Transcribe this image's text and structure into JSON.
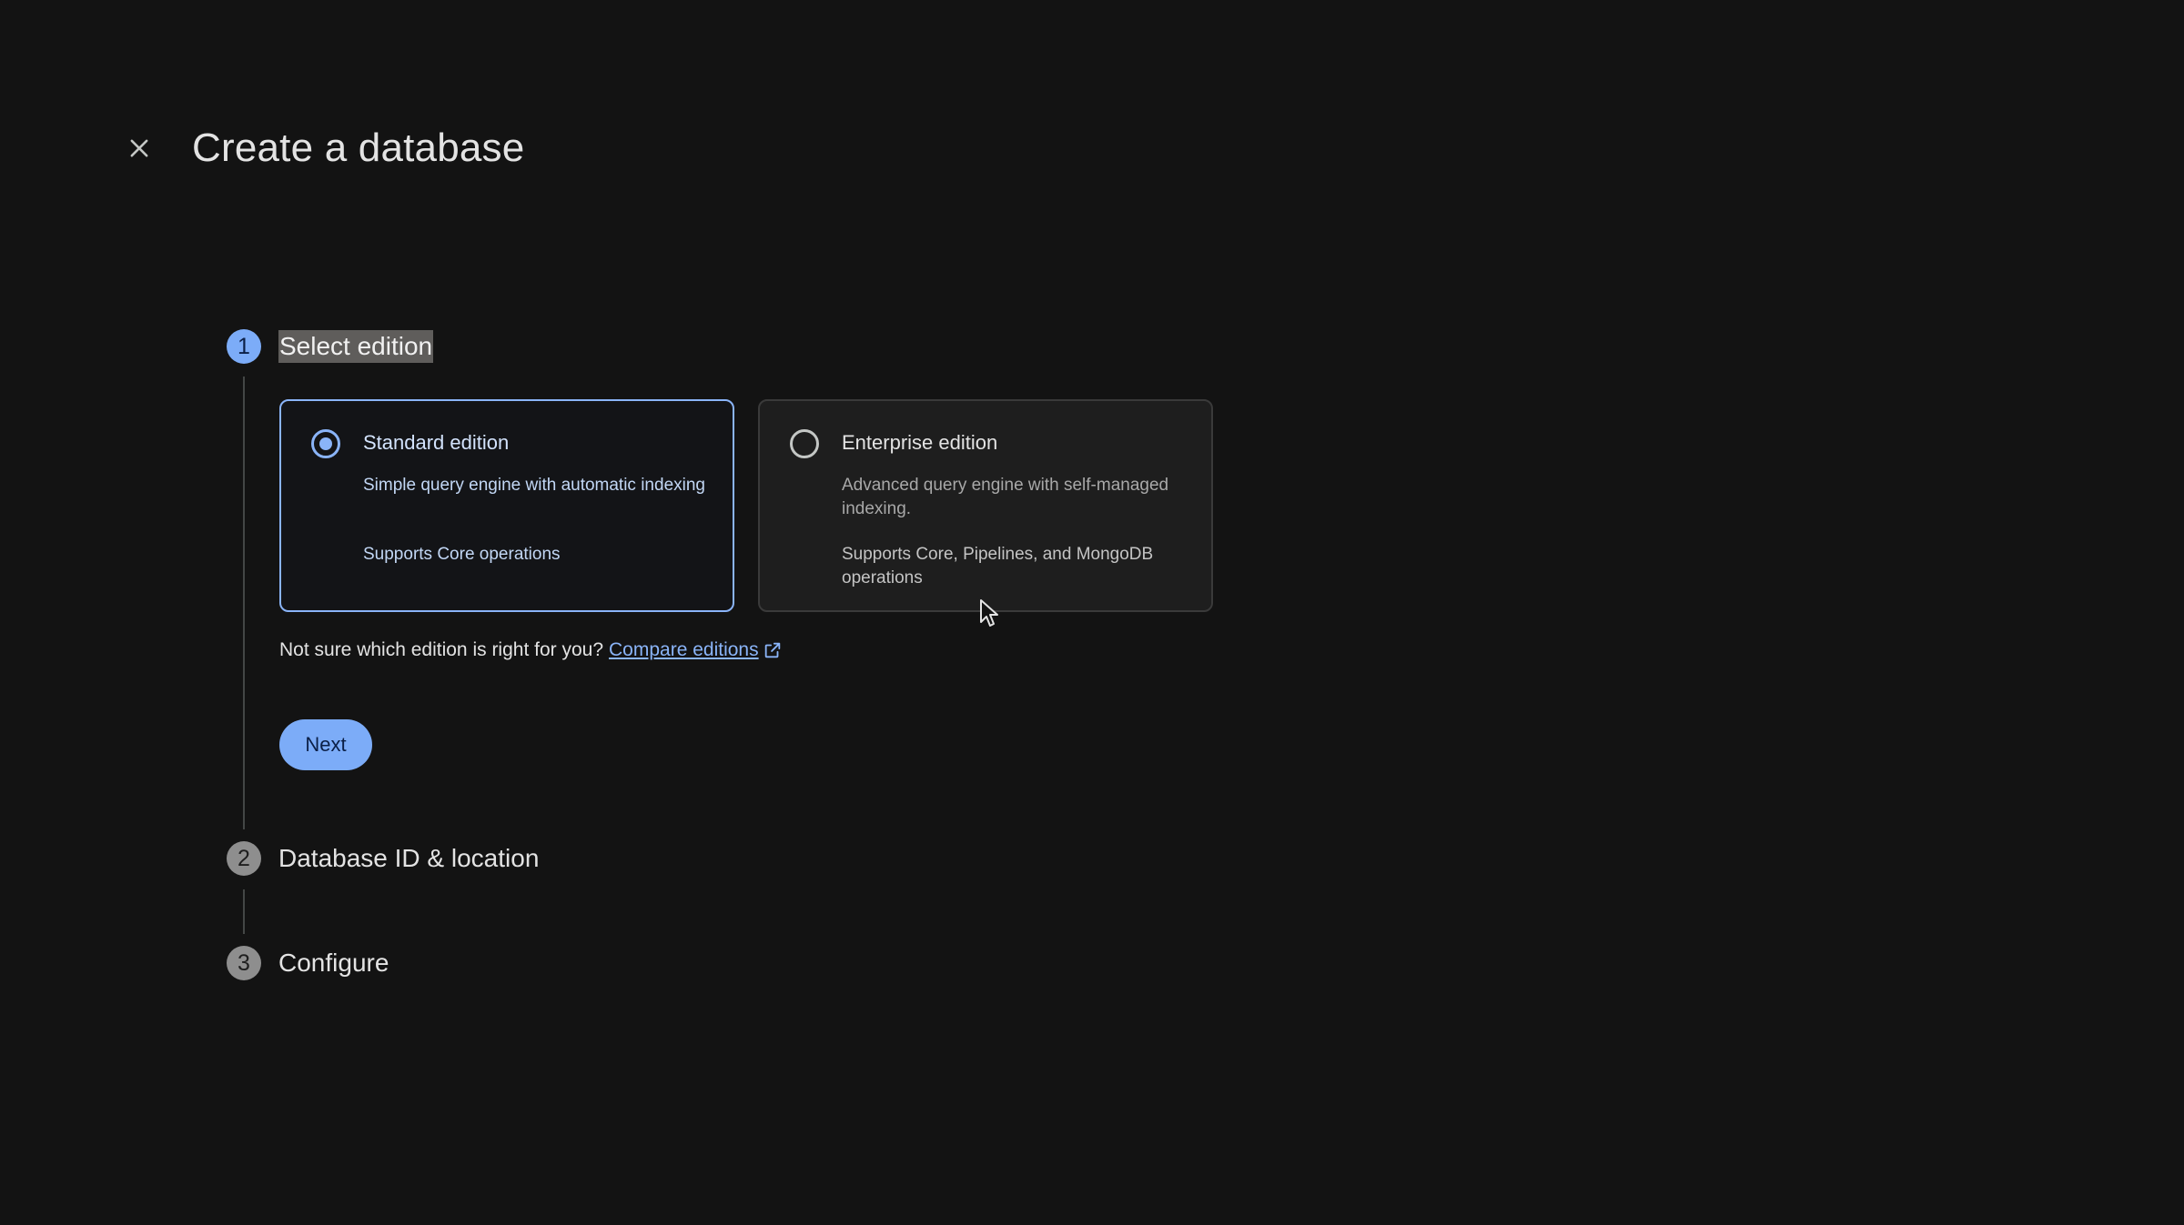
{
  "header": {
    "title": "Create a database",
    "close_icon": "close-icon"
  },
  "stepper": {
    "steps": [
      {
        "number": "1",
        "label": "Select edition",
        "state": "active"
      },
      {
        "number": "2",
        "label": "Database ID & location",
        "state": "inactive"
      },
      {
        "number": "3",
        "label": "Configure",
        "state": "inactive"
      }
    ]
  },
  "editions": [
    {
      "title": "Standard edition",
      "description": "Simple query engine with automatic indexing",
      "support": "Supports Core operations",
      "selected": true
    },
    {
      "title": "Enterprise edition",
      "description": "Advanced query engine with self-managed indexing.",
      "support": "Supports Core, Pipelines, and MongoDB operations",
      "selected": false
    }
  ],
  "help": {
    "text": "Not sure which edition is right for you?",
    "link_label": "Compare editions",
    "link_icon": "open-in-new-icon"
  },
  "actions": {
    "next_label": "Next"
  },
  "colors": {
    "background": "#131313",
    "accent": "#8ab4f8",
    "primary_button": "#7cacf8"
  }
}
